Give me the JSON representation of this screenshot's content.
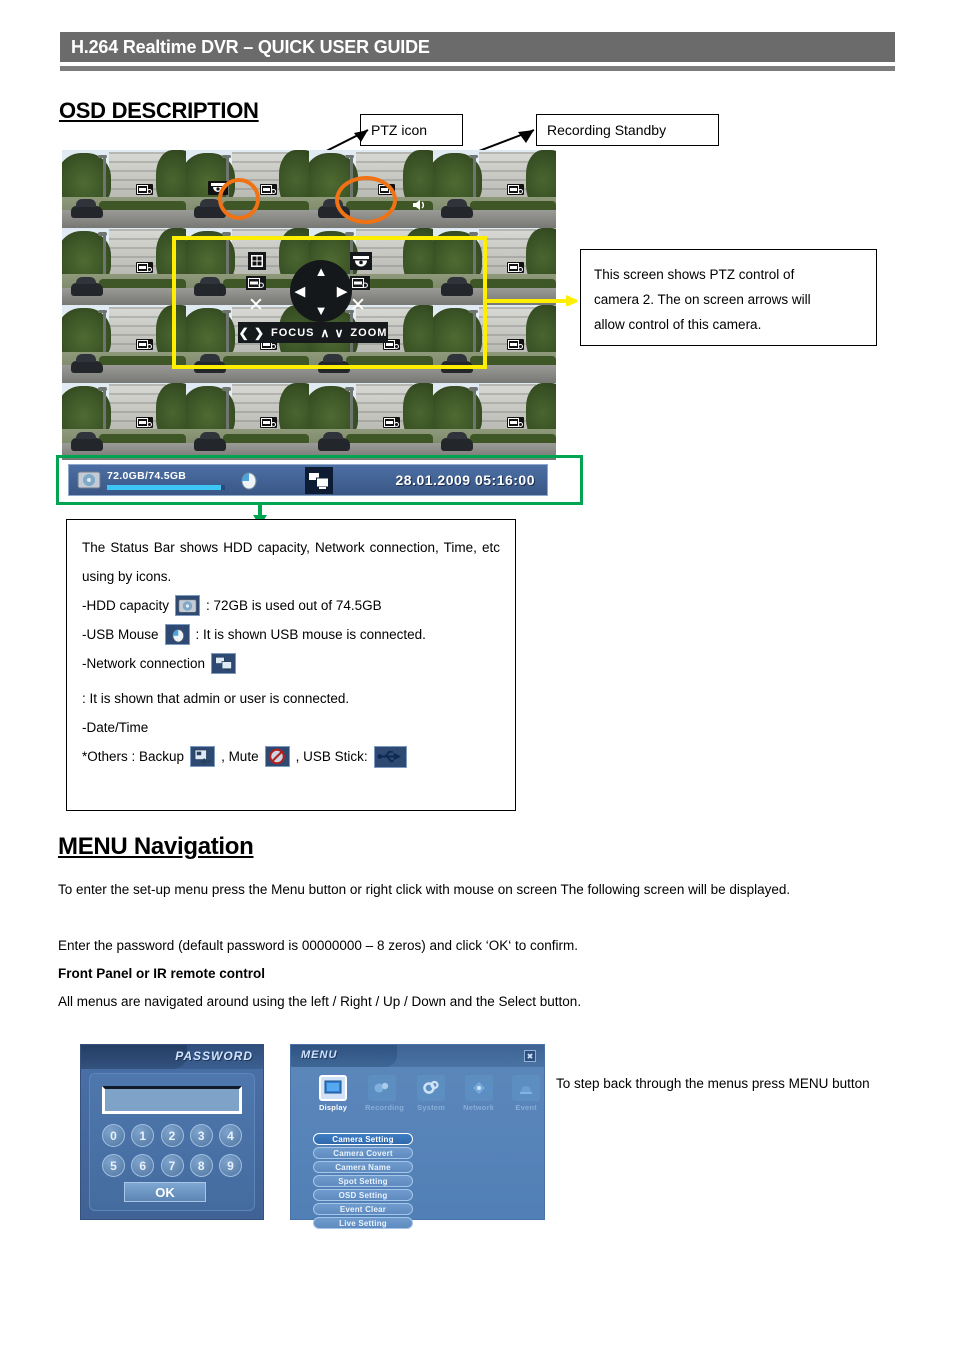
{
  "header": {
    "title": "H.264 Realtime DVR – QUICK USER GUIDE"
  },
  "sections": {
    "osd": {
      "title": "OSD DESCRIPTION"
    },
    "menu": {
      "title": "MENU Navigation"
    }
  },
  "callouts": {
    "ptz_icon": "PTZ icon",
    "recording_standby": "Recording Standby"
  },
  "ptz_overlay": {
    "focus_label": "FOCUS",
    "zoom_label": "ZOOM",
    "focus_glyphs": "❮ ❯",
    "zoom_glyphs": "∧ ∨",
    "up": "▲",
    "down": "▼",
    "left": "◀",
    "right": "▶"
  },
  "status_bar": {
    "hdd_capacity": "72.0GB/74.5GB",
    "hdd_used_percent": 97,
    "datetime": "28.01.2009  05:16:00",
    "icons": [
      "hdd-icon",
      "usb-mouse-icon",
      "network-icon"
    ]
  },
  "desc_ptz": {
    "line1": "This screen shows PTZ control of",
    "line2": "camera 2. The on screen arrows will",
    "line3": "allow control of this camera."
  },
  "desc_status": {
    "intro": "The Status Bar shows HDD capacity, Network connection, Time, etc using by icons.",
    "hdd_label": "-HDD capacity",
    "hdd_value": ": 72GB is used out of 74.5GB",
    "mouse_label": "-USB Mouse",
    "mouse_value": ": It is shown USB mouse is connected.",
    "network_label": "-Network connection",
    "network_value": ": It is shown that admin or user is connected.",
    "datetime_label": "-Date/Time",
    "others_prefix": "*Others : Backup",
    "others_mute": ", Mute",
    "others_usb": ", USB Stick:"
  },
  "menu_text": {
    "p1": "To enter the set-up menu press the Menu button or right click with mouse on screen The following screen will be displayed.",
    "p2": "Enter the password (default password is 00000000 – 8 zeros) and click ‘OK‘ to confirm.",
    "p3": "Front Panel or IR remote control",
    "p4": "All menus are navigated around using the left / Right / Up / Down and the Select button.",
    "note": "To step back through the menus press MENU button"
  },
  "password_dialog": {
    "title": "PASSWORD",
    "field_value": "",
    "keys_row1": [
      "0",
      "1",
      "2",
      "3",
      "4"
    ],
    "keys_row2": [
      "5",
      "6",
      "7",
      "8",
      "9"
    ],
    "ok_label": "OK"
  },
  "menu_screen": {
    "title": "MENU",
    "close_label": "✖",
    "tabs": [
      {
        "label": "Display",
        "icon": "display-icon",
        "active": true
      },
      {
        "label": "Recording",
        "icon": "recording-icon",
        "active": false
      },
      {
        "label": "System",
        "icon": "system-icon",
        "active": false
      },
      {
        "label": "Network",
        "icon": "network-icon",
        "active": false
      },
      {
        "label": "Event",
        "icon": "event-icon",
        "active": false
      }
    ],
    "items": [
      {
        "label": "Camera Setting",
        "selected": true
      },
      {
        "label": "Camera Covert",
        "selected": false
      },
      {
        "label": "Camera Name",
        "selected": false
      },
      {
        "label": "Spot Setting",
        "selected": false
      },
      {
        "label": "OSD Setting",
        "selected": false
      },
      {
        "label": "Event Clear",
        "selected": false
      },
      {
        "label": "Live Setting",
        "selected": false
      }
    ]
  },
  "colors": {
    "header_bg": "#6b6b6b",
    "highlight_orange": "#ef7215",
    "highlight_yellow": "#ffee00",
    "highlight_green": "#00a551",
    "status_bar_blue": "#4c6fa4",
    "progress_cyan": "#3dc6f5"
  }
}
